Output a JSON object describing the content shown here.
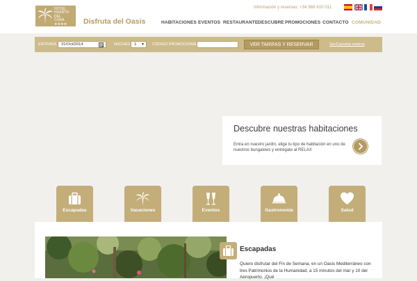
{
  "header": {
    "logo_text": "HOTEL\nHUERTO\nDEL\nCURA\n★★★★",
    "tagline": "Disfruta del Oasis",
    "contact": "Información y reservas: +34 966 610 011",
    "languages": [
      "Español",
      "English",
      "Français",
      "Русский"
    ]
  },
  "nav": {
    "items": [
      "HABITACIONES",
      "EVENTOS",
      "RESTAURANTE",
      "DESCUBRE",
      "PROMOCIONES",
      "CONTACTO",
      "COMUNIDAD"
    ],
    "active": "COMUNIDAD"
  },
  "booking": {
    "entrada_label": "ENTRADA",
    "entrada_value": "31/Oct/2014",
    "noches_label": "NOCHES",
    "noches_value": "1",
    "codigo_label": "CÓDIGO PROMOCIONAL",
    "codigo_value": "",
    "submit_label": "VER TARIFAS Y RESERVAR",
    "manage_link": "Ver/Cancelar reserva"
  },
  "promo": {
    "title": "Descubre nuestras habitaciones",
    "text": "Entra en nuestro jardín, elige tu tipo de habitación en uno de nuestros bungalows y entrégate al RELAX"
  },
  "categories": [
    {
      "label": "Escapadas",
      "icon": "suitcase-icon"
    },
    {
      "label": "Vacaciones",
      "icon": "palm-tree-icon"
    },
    {
      "label": "Eventos",
      "icon": "champagne-glasses-icon"
    },
    {
      "label": "Gastronomía",
      "icon": "cloche-icon"
    },
    {
      "label": "Salud",
      "icon": "heart-icon"
    }
  ],
  "feature": {
    "title": "Escapadas",
    "text": "Quiero disfrutar del Fin de Semana, en un Oasis Mediterráneo con tres Patrimonios de la Humanidad, a 15 minutos del mar y 10 del Aeropuerto. ¡Qué"
  },
  "colors": {
    "gold": "#c3ad79",
    "gold_dark": "#b39a60",
    "booking_bar": "#cdbb8b",
    "page_bg": "#f1f0ed"
  }
}
